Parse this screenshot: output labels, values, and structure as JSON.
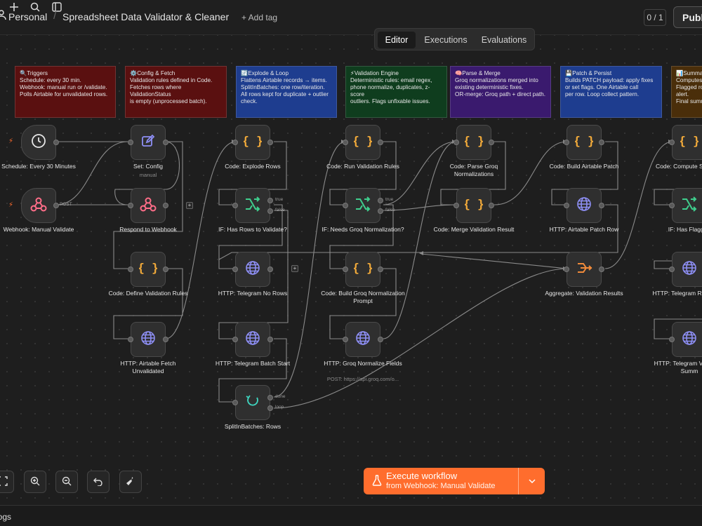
{
  "header": {
    "project": "Personal",
    "workflow_name": "Spreadsheet Data Validator & Cleaner",
    "add_tag": "+ Add tag",
    "counter": "0 / 1",
    "publish": "Publish"
  },
  "tabs": [
    {
      "label": "Editor",
      "active": true
    },
    {
      "label": "Executions",
      "active": false
    },
    {
      "label": "Evaluations",
      "active": false
    }
  ],
  "notes": [
    {
      "title": "🔍Triggers",
      "body": "Schedule: every 30 min.\nWebhook: manual run or /validate.\nPolls Airtable for unvalidated rows.",
      "color": "#5a1010"
    },
    {
      "title": "⚙️Config & Fetch",
      "body": "Validation rules defined in Code.\nFetches rows where ValidationStatus\nis empty (unprocessed batch).",
      "color": "#5a1010"
    },
    {
      "title": "🔄Explode & Loop",
      "body": "Flattens Airtable records → items.\nSplitInBatches: one row/iteration.\nAll rows kept for duplicate + outlier\ncheck.",
      "color": "#1e3d8f"
    },
    {
      "title": "⚡Validation Engine",
      "body": "Deterministic rules: email regex,\nphone normalize, duplicates, z-score\noutliers. Flags unfixable issues.",
      "color": "#0f3d1e"
    },
    {
      "title": "🧠Parse & Merge",
      "body": "Groq normalizations merged into\nexisting deterministic fixes.\nOR-merge: Groq path + direct path.",
      "color": "#3a1a6e"
    },
    {
      "title": "💾Patch & Persist",
      "body": "Builds PATCH payload: apply fixes\nor set flags. One Airtable call\nper row. Loop collect pattern.",
      "color": "#1e3d8f"
    },
    {
      "title": "📊Summary",
      "body": "Computes\nFlagged ro\nalert.\nFinal summ",
      "color": "#4a2e0a"
    }
  ],
  "nodes": [
    {
      "label": "Schedule: Every 30 Minutes",
      "icon": "clock-icon"
    },
    {
      "label": "Webhook: Manual Validate",
      "icon": "webhook-icon",
      "port": "POST"
    },
    {
      "label": "Set: Config",
      "sub": "manual",
      "icon": "pencil-icon"
    },
    {
      "label": "Respond to Webhook",
      "icon": "webhook-icon"
    },
    {
      "label": "Code: Define Validation Rules",
      "icon": "code-braces-icon"
    },
    {
      "label": "HTTP: Airtable Fetch Unvalidated",
      "icon": "globe-icon"
    },
    {
      "label": "Code: Explode Rows",
      "icon": "code-braces-icon"
    },
    {
      "label": "IF: Has Rows to Validate?",
      "icon": "branch-icon",
      "true": "true",
      "false": "false"
    },
    {
      "label": "HTTP: Telegram No Rows",
      "icon": "globe-icon"
    },
    {
      "label": "HTTP: Telegram Batch Start",
      "icon": "globe-icon"
    },
    {
      "label": "SplitInBatches: Rows",
      "icon": "loop-icon",
      "done": "done",
      "loop": "loop"
    },
    {
      "label": "Code: Run Validation Rules",
      "icon": "code-braces-icon"
    },
    {
      "label": "IF: Needs Groq Normalization?",
      "icon": "branch-icon",
      "true": "true",
      "false": "false"
    },
    {
      "label": "Code: Build Groq Normalization Prompt",
      "icon": "code-braces-icon"
    },
    {
      "label": "HTTP: Groq Normalize Fields",
      "sub": "POST: https://api.groq.com/o...",
      "icon": "globe-icon"
    },
    {
      "label": "Code: Parse Groq Normalizations",
      "icon": "code-braces-icon"
    },
    {
      "label": "Code: Merge Validation Result",
      "icon": "code-braces-icon"
    },
    {
      "label": "Code: Build Airtable Patch",
      "icon": "code-braces-icon"
    },
    {
      "label": "HTTP: Airtable Patch Row",
      "icon": "globe-icon"
    },
    {
      "label": "Aggregate: Validation Results",
      "icon": "aggregate-icon"
    },
    {
      "label": "Code: Compute Statistics",
      "icon": "code-braces-icon"
    },
    {
      "label": "IF: Has Flagged",
      "icon": "branch-icon"
    },
    {
      "label": "HTTP: Telegram Row Detail",
      "icon": "globe-icon"
    },
    {
      "label": "HTTP: Telegram Validation Summ",
      "icon": "globe-icon"
    }
  ],
  "controls": {
    "fit": "fit-view-icon",
    "zoom_in": "zoom-in-icon",
    "zoom_out": "zoom-out-icon",
    "undo": "undo-icon",
    "clean": "broom-icon"
  },
  "execute": {
    "title": "Execute workflow",
    "from": "from Webhook: Manual Validate"
  },
  "bottom": {
    "logs": "Logs"
  },
  "colors": {
    "accent": "#ff6d2d",
    "canvas": "#1e1e1e"
  }
}
